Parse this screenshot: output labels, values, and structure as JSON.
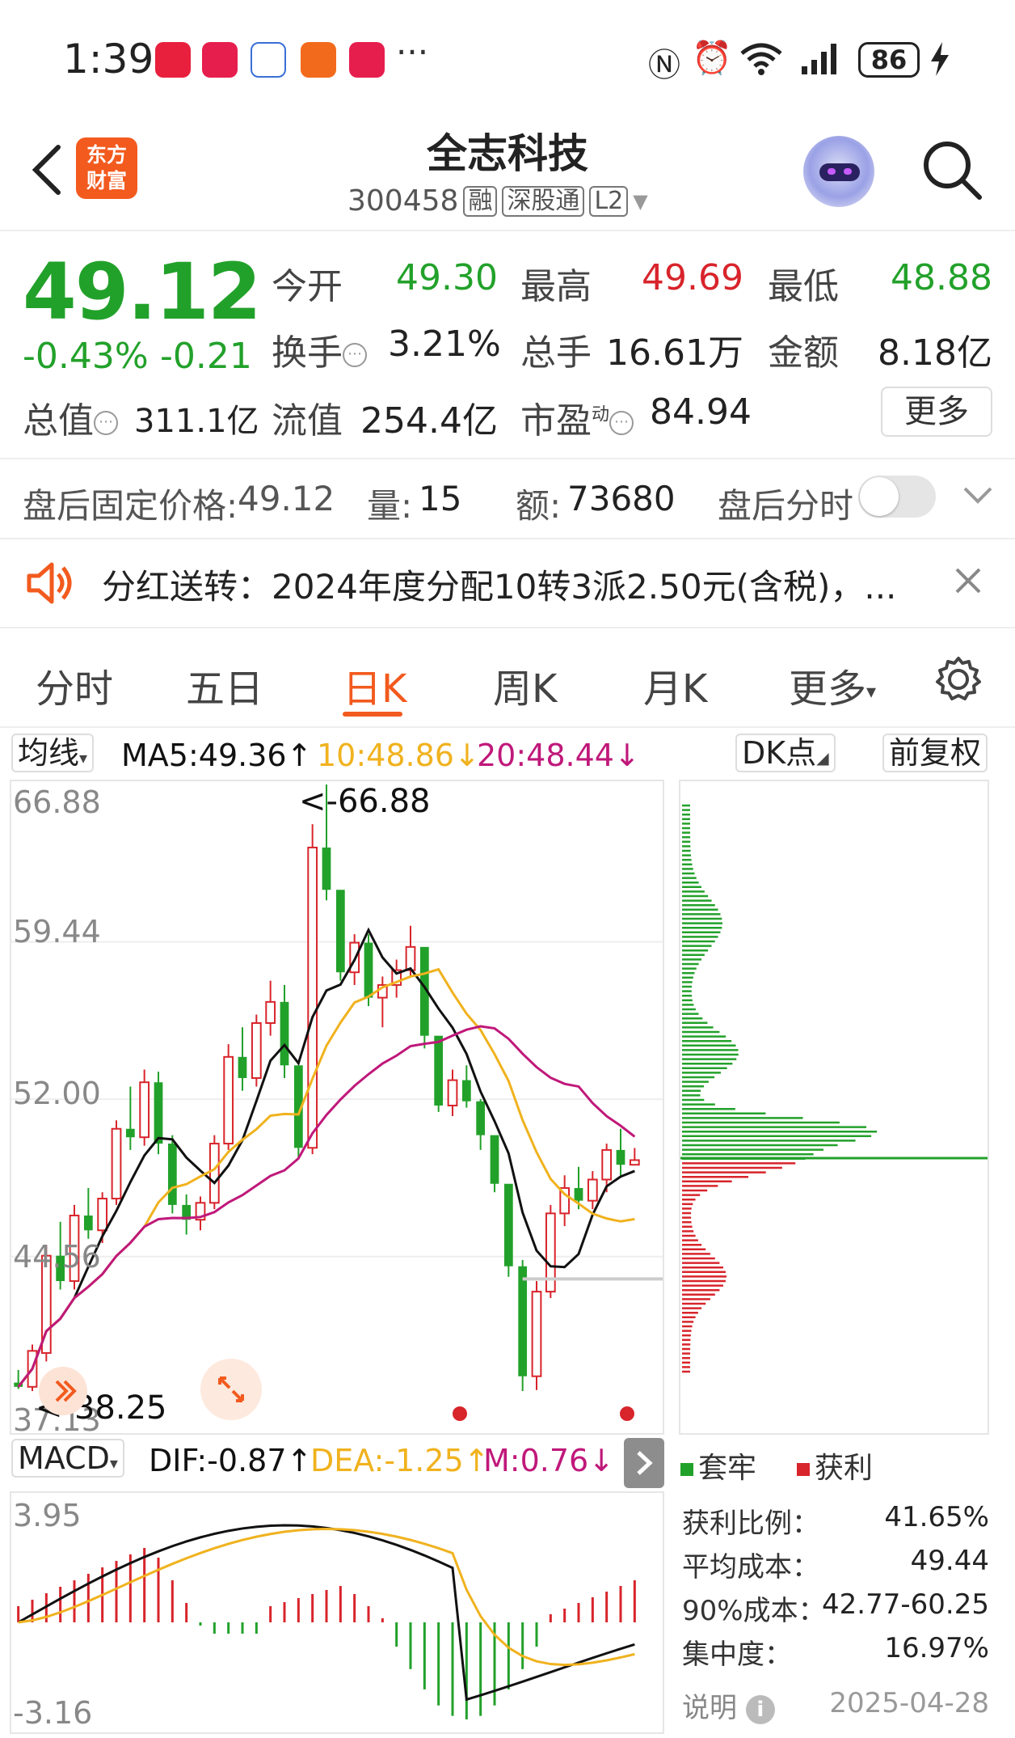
{
  "status_bar": {
    "time": "1:39",
    "battery": "86",
    "overflow": "···"
  },
  "header": {
    "logo_line1": "东方",
    "logo_line2": "财富",
    "stock_name": "全志科技",
    "stock_code": "300458",
    "tags": [
      "融",
      "深股通",
      "L2"
    ]
  },
  "quote": {
    "price": "49.12",
    "change_pct": "-0.43%",
    "change_abs": "-0.21",
    "fields": [
      {
        "label": "今开",
        "value": "49.30",
        "color": "#22a12a"
      },
      {
        "label": "最高",
        "value": "49.69",
        "color": "#d8242b"
      },
      {
        "label": "最低",
        "value": "48.88",
        "color": "#22a12a"
      },
      {
        "label": "换手",
        "value": "3.21%",
        "color": "#222"
      },
      {
        "label": "总手",
        "value": "16.61万",
        "color": "#222"
      },
      {
        "label": "金额",
        "value": "8.18亿",
        "color": "#222"
      },
      {
        "label": "总值",
        "value": "311.1亿",
        "color": "#222"
      },
      {
        "label": "流值",
        "value": "254.4亿",
        "color": "#222"
      },
      {
        "label": "市盈",
        "label_sup": "动",
        "value": "84.94",
        "color": "#222"
      }
    ],
    "more_label": "更多"
  },
  "after_hours": {
    "price_label": "盘后固定价格:",
    "price": "49.12",
    "vol_label": "量:",
    "vol": "15",
    "amt_label": "额:",
    "amt": "73680",
    "toggle_label": "盘后分时"
  },
  "announcement": {
    "text": "分红送转：2024年度分配10转3派2.50元(含税)，..."
  },
  "tabs": [
    "分时",
    "五日",
    "日K",
    "周K",
    "月K",
    "更多"
  ],
  "active_tab": "日K",
  "ma": {
    "selector": "均线",
    "ma5": "MA5:49.36↑",
    "ma10": "10:48.86↓",
    "ma20": "20:48.44↓",
    "dk_label": "DK点",
    "adjust_label": "前复权"
  },
  "kchart": {
    "y_labels": [
      "66.88",
      "59.44",
      "52.00",
      "44.56",
      "37.13"
    ],
    "high_annotation": "<-66.88",
    "low_annotation": "<-38.25"
  },
  "macd": {
    "selector": "MACD",
    "dif": "DIF:-0.87↑",
    "dea": "DEA:-1.25↑",
    "m": "M:0.76↓",
    "y_top": "3.95",
    "y_bottom": "-3.16"
  },
  "chips": {
    "legend_trapped": "套牢",
    "legend_profit": "获利",
    "stats": [
      {
        "label": "获利比例：",
        "value": "41.65%"
      },
      {
        "label": "平均成本：",
        "value": "49.44"
      },
      {
        "label": "90%成本：",
        "value": "42.77-60.25"
      },
      {
        "label": "集中度：",
        "value": "16.97%"
      }
    ],
    "explain_label": "说明",
    "date": "2025-04-28"
  },
  "colors": {
    "up": "#d8242b",
    "down": "#22a12a",
    "accent": "#f25a1e",
    "ma5": "#111111",
    "ma10": "#f0b21e",
    "ma20": "#c0187a"
  },
  "chart_data": {
    "type": "candlestick",
    "title": "",
    "ylim": [
      37.13,
      66.88
    ],
    "candles_ohlc": [
      [
        38.6,
        39.2,
        38.3,
        38.4
      ],
      [
        38.4,
        40.4,
        38.2,
        40.1
      ],
      [
        40.0,
        45.1,
        39.6,
        44.6
      ],
      [
        44.6,
        46.2,
        43.0,
        43.4
      ],
      [
        43.4,
        47.0,
        43.0,
        46.5
      ],
      [
        46.5,
        47.8,
        45.4,
        45.8
      ],
      [
        45.8,
        47.6,
        45.2,
        47.3
      ],
      [
        47.3,
        51.0,
        47.0,
        50.6
      ],
      [
        50.6,
        52.6,
        49.6,
        50.2
      ],
      [
        50.2,
        53.4,
        49.8,
        52.8
      ],
      [
        52.8,
        53.3,
        49.4,
        49.9
      ],
      [
        49.9,
        50.3,
        46.6,
        47.0
      ],
      [
        47.0,
        47.5,
        45.6,
        46.3
      ],
      [
        46.3,
        47.4,
        45.8,
        47.1
      ],
      [
        47.1,
        50.3,
        46.8,
        49.9
      ],
      [
        49.9,
        54.6,
        49.6,
        54.0
      ],
      [
        54.0,
        55.4,
        52.4,
        53.0
      ],
      [
        53.0,
        56.0,
        52.6,
        55.6
      ],
      [
        55.6,
        57.6,
        55.0,
        56.6
      ],
      [
        56.6,
        57.4,
        53.0,
        53.6
      ],
      [
        53.6,
        50.2,
        49.2,
        49.7
      ],
      [
        49.7,
        65.0,
        49.4,
        63.9
      ],
      [
        63.9,
        66.88,
        61.4,
        61.9
      ],
      [
        61.9,
        60.6,
        57.6,
        58.0
      ],
      [
        58.0,
        59.8,
        57.4,
        59.4
      ],
      [
        59.4,
        59.8,
        56.4,
        56.8
      ],
      [
        56.8,
        57.8,
        55.4,
        57.4
      ],
      [
        57.4,
        58.6,
        56.8,
        58.1
      ],
      [
        58.1,
        60.2,
        57.8,
        59.2
      ],
      [
        59.2,
        57.6,
        54.4,
        55.0
      ],
      [
        55.0,
        54.4,
        51.4,
        51.7
      ],
      [
        51.7,
        53.4,
        51.2,
        52.9
      ],
      [
        52.9,
        53.6,
        51.6,
        51.9
      ],
      [
        51.9,
        52.0,
        49.6,
        50.3
      ],
      [
        50.3,
        49.9,
        47.6,
        48.0
      ],
      [
        48.0,
        46.4,
        43.6,
        44.1
      ],
      [
        44.1,
        44.4,
        38.2,
        38.9
      ],
      [
        38.9,
        43.4,
        38.25,
        42.9
      ],
      [
        42.9,
        47.0,
        42.6,
        46.6
      ],
      [
        46.6,
        48.4,
        46.0,
        47.8
      ],
      [
        47.8,
        48.8,
        46.8,
        47.2
      ],
      [
        47.2,
        48.6,
        46.8,
        48.2
      ],
      [
        48.2,
        49.9,
        47.6,
        49.6
      ],
      [
        49.6,
        50.6,
        48.4,
        48.9
      ],
      [
        48.9,
        49.69,
        48.88,
        49.12
      ]
    ]
  }
}
